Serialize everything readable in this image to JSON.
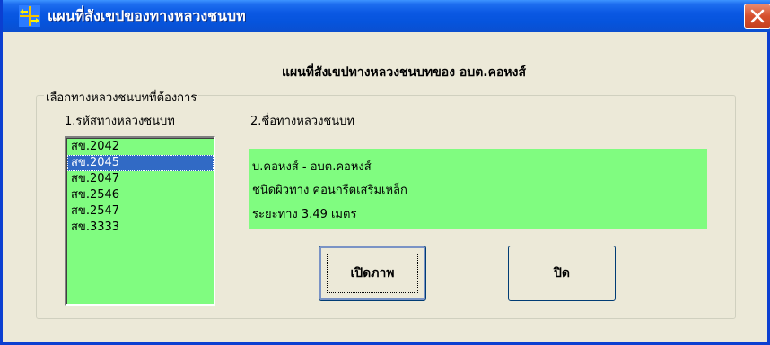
{
  "window": {
    "title": "แผนที่สังเขปของทางหลวงชนบท",
    "icon": "map-arrows-icon",
    "close_icon": "close-icon"
  },
  "main": {
    "heading": "แผนที่สังเขปทางหลวงชนบทของ อบต.คอหงส์",
    "group_label": "เลือกทางหลวงชนบทที่ต้องการ",
    "code_label": "1.รหัสทางหลวงชนบท",
    "name_label": "2.ชื่อทางหลวงชนบท",
    "road_codes": [
      "สข.2042",
      "สข.2045",
      "สข.2047",
      "สข.2546",
      "สข.2547",
      "สข.3333"
    ],
    "selected_index": 1,
    "info": {
      "route": "บ.คอหงส์ - อบต.คอหงส์",
      "surface": "ชนิดผิวทาง  คอนกรีตเสริมเหล็ก",
      "distance": "ระยะทาง  3.49  เมตร"
    }
  },
  "buttons": {
    "open_image": "เปิดภาพ",
    "close": "ปิด"
  },
  "colors": {
    "titlebar": "#0a58e3",
    "list_background": "#80fc80",
    "selection": "#316ac5",
    "face": "#ece9d8"
  }
}
